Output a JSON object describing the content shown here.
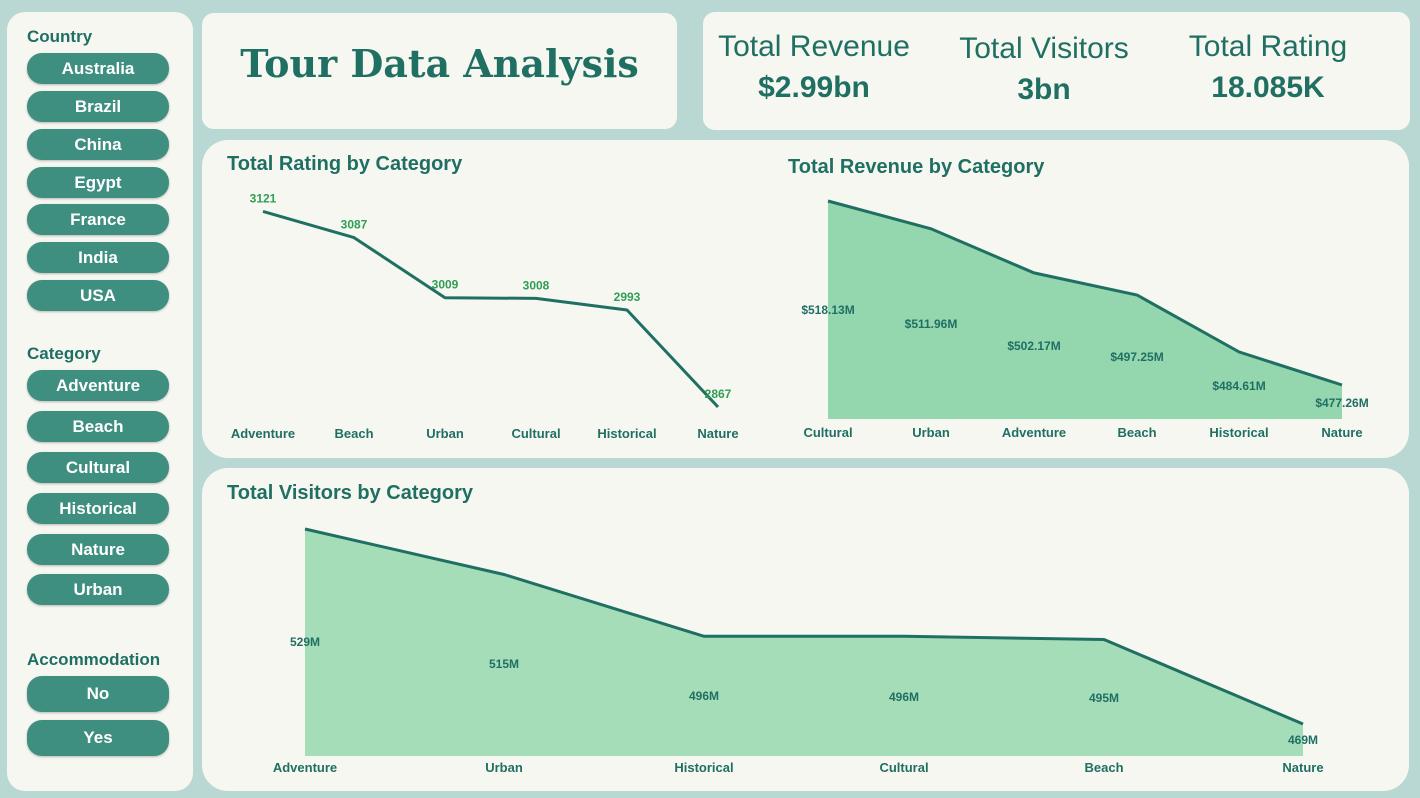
{
  "dashboard": {
    "title": "Tour Data Analysis"
  },
  "kpis": [
    {
      "label": "Total Revenue",
      "value": "$2.99bn"
    },
    {
      "label": "Total Visitors",
      "value": "3bn"
    },
    {
      "label": "Total Rating",
      "value": "18.085K"
    }
  ],
  "filters": {
    "country": {
      "title": "Country",
      "items": [
        "Australia",
        "Brazil",
        "China",
        "Egypt",
        "France",
        "India",
        "USA"
      ]
    },
    "category": {
      "title": "Category",
      "items": [
        "Adventure",
        "Beach",
        "Cultural",
        "Historical",
        "Nature",
        "Urban"
      ]
    },
    "accommodation": {
      "title": "Accommodation",
      "items": [
        "No",
        "Yes"
      ]
    }
  },
  "colors": {
    "accent": "#1f6f63",
    "button": "#3f8f80",
    "area_revenue": "#94d6ae",
    "area_visitors": "#a6ddb9",
    "background": "#b9d8d3",
    "panel": "#f7f7f1"
  },
  "chart_data": [
    {
      "type": "line",
      "title": "Total Rating by Category",
      "categories": [
        "Adventure",
        "Beach",
        "Urban",
        "Cultural",
        "Historical",
        "Nature"
      ],
      "values": [
        3121,
        3087,
        3009,
        3008,
        2993,
        2867
      ],
      "labels": [
        "3121",
        "3087",
        "3009",
        "3008",
        "2993",
        "2867"
      ],
      "xlabel": "",
      "ylabel": "",
      "grid": false
    },
    {
      "type": "area",
      "title": "Total Revenue by Category",
      "categories": [
        "Cultural",
        "Urban",
        "Adventure",
        "Beach",
        "Historical",
        "Nature"
      ],
      "values": [
        518.13,
        511.96,
        502.17,
        497.25,
        484.61,
        477.26
      ],
      "labels": [
        "$518.13M",
        "$511.96M",
        "$502.17M",
        "$497.25M",
        "$484.61M",
        "$477.26M"
      ],
      "xlabel": "",
      "ylabel": "",
      "grid": false
    },
    {
      "type": "area",
      "title": "Total Visitors by Category",
      "categories": [
        "Adventure",
        "Urban",
        "Historical",
        "Cultural",
        "Beach",
        "Nature"
      ],
      "values": [
        529,
        515,
        496,
        496,
        495,
        469
      ],
      "labels": [
        "529M",
        "515M",
        "496M",
        "496M",
        "495M",
        "469M"
      ],
      "xlabel": "",
      "ylabel": "",
      "grid": false
    }
  ]
}
